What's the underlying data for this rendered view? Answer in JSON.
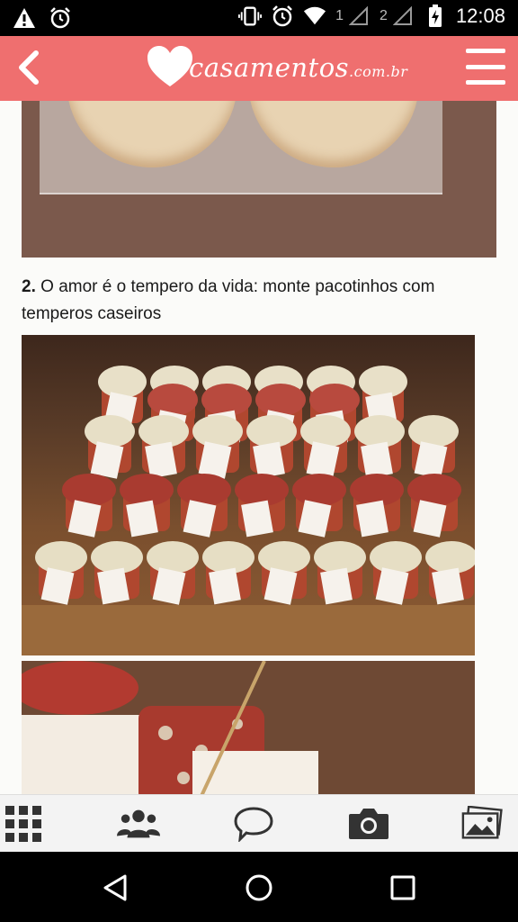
{
  "status_bar": {
    "sim1_label": "1",
    "sim2_label": "2",
    "time": "12:08",
    "icons": [
      "warning-icon",
      "alarm-icon",
      "vibrate-icon",
      "alarm-icon",
      "wifi-icon",
      "signal-icon",
      "signal-icon",
      "battery-charging-icon"
    ]
  },
  "app_bar": {
    "logo_main": "casamentos",
    "logo_suffix": ".com.br",
    "brand_color": "#ef6f6f",
    "icons": [
      "back-arrow-icon",
      "hamburger-menu-icon"
    ]
  },
  "article": {
    "item_number": "2.",
    "item_text": "O amor é o tempero da vida: monte pacotinhos com temperos caseiros"
  },
  "bottom_bar": {
    "icons": [
      "grid-icon",
      "people-icon",
      "chat-icon",
      "camera-icon",
      "photos-icon"
    ]
  },
  "nav_bar": {
    "icons": [
      "back-triangle-icon",
      "home-circle-icon",
      "recents-square-icon"
    ]
  }
}
